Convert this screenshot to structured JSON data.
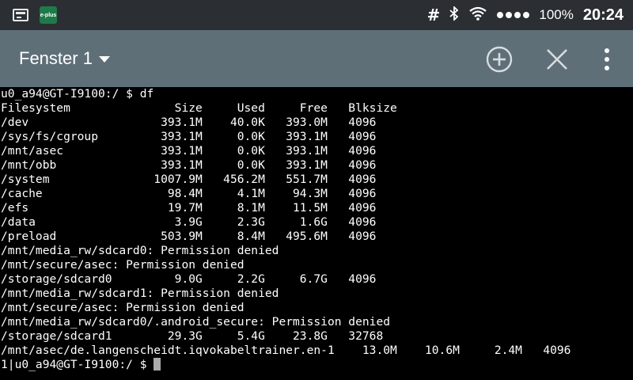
{
  "status_bar": {
    "notification_icons": [
      "terminal-icon",
      "eplus-icon"
    ],
    "eplus_label": "e-plus",
    "icons": [
      "hash-icon",
      "bluetooth-icon",
      "wifi-icon",
      "signal-icon"
    ],
    "battery": "100%",
    "time": "20:24"
  },
  "action_bar": {
    "window_title": "Fenster 1",
    "buttons": [
      "add-window-icon",
      "close-window-icon",
      "overflow-menu-icon"
    ],
    "background": "#5f6f78"
  },
  "terminal": {
    "background": "#000000",
    "foreground": "#ffffff",
    "lines": [
      "u0_a94@GT-I9100:/ $ df",
      "Filesystem               Size     Used     Free   Blksize",
      "/dev                   393.1M    40.0K   393.0M   4096",
      "/sys/fs/cgroup         393.1M     0.0K   393.1M   4096",
      "/mnt/asec              393.1M     0.0K   393.1M   4096",
      "/mnt/obb               393.1M     0.0K   393.1M   4096",
      "/system               1007.9M   456.2M   551.7M   4096",
      "/cache                  98.4M     4.1M    94.3M   4096",
      "/efs                    19.7M     8.1M    11.5M   4096",
      "/data                    3.9G     2.3G     1.6G   4096",
      "/preload               503.9M     8.4M   495.6M   4096",
      "/mnt/media_rw/sdcard0: Permission denied",
      "/mnt/secure/asec: Permission denied",
      "/storage/sdcard0         9.0G     2.2G     6.7G   4096",
      "/mnt/media_rw/sdcard1: Permission denied",
      "/mnt/secure/asec: Permission denied",
      "/mnt/media_rw/sdcard0/.android_secure: Permission denied",
      "/storage/sdcard1        29.3G     5.4G    23.8G   32768",
      "/mnt/asec/de.langenscheidt.iqvokabeltrainer.en-1    13.0M    10.6M     2.4M   4096"
    ],
    "prompt": "1|u0_a94@GT-I9100:/ $ "
  }
}
